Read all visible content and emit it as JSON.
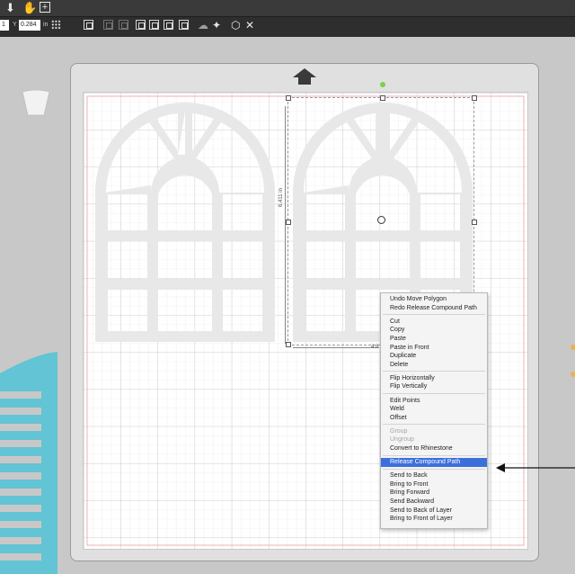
{
  "toolbar": {
    "icons": [
      "down-arrow-icon",
      "hand-icon",
      "add-box-icon"
    ],
    "x_value": "1",
    "y_label": "Y",
    "y_value": "0.284",
    "unit": "in"
  },
  "canvas": {
    "height_dimension": "6.411 in",
    "width_dimension": "4.8"
  },
  "context_menu": {
    "groups": [
      [
        {
          "label": "Undo Move Polygon",
          "enabled": true
        },
        {
          "label": "Redo Release Compound Path",
          "enabled": true
        }
      ],
      [
        {
          "label": "Cut",
          "enabled": true
        },
        {
          "label": "Copy",
          "enabled": true
        },
        {
          "label": "Paste",
          "enabled": true
        },
        {
          "label": "Paste in Front",
          "enabled": true
        },
        {
          "label": "Duplicate",
          "enabled": true
        },
        {
          "label": "Delete",
          "enabled": true
        }
      ],
      [
        {
          "label": "Flip Horizontally",
          "enabled": true
        },
        {
          "label": "Flip Vertically",
          "enabled": true
        }
      ],
      [
        {
          "label": "Edit Points",
          "enabled": true
        },
        {
          "label": "Weld",
          "enabled": true
        },
        {
          "label": "Offset",
          "enabled": true
        }
      ],
      [
        {
          "label": "Group",
          "enabled": false
        },
        {
          "label": "Ungroup",
          "enabled": false
        },
        {
          "label": "Convert to Rhinestone",
          "enabled": true
        }
      ],
      [
        {
          "label": "Release Compound Path",
          "enabled": true,
          "highlighted": true
        }
      ],
      [
        {
          "label": "Send to Back",
          "enabled": true
        },
        {
          "label": "Bring to Front",
          "enabled": true
        },
        {
          "label": "Bring Forward",
          "enabled": true
        },
        {
          "label": "Send Backward",
          "enabled": true
        },
        {
          "label": "Send to Back of Layer",
          "enabled": true
        },
        {
          "label": "Bring to Front of Layer",
          "enabled": true
        }
      ]
    ]
  },
  "colors": {
    "highlight": "#3d6fdc",
    "shape_fill": "#e8e8e8",
    "teal_shape": "#62c4d4",
    "grid_line": "#d9d9d9",
    "margin_line": "#e8a0a0"
  }
}
